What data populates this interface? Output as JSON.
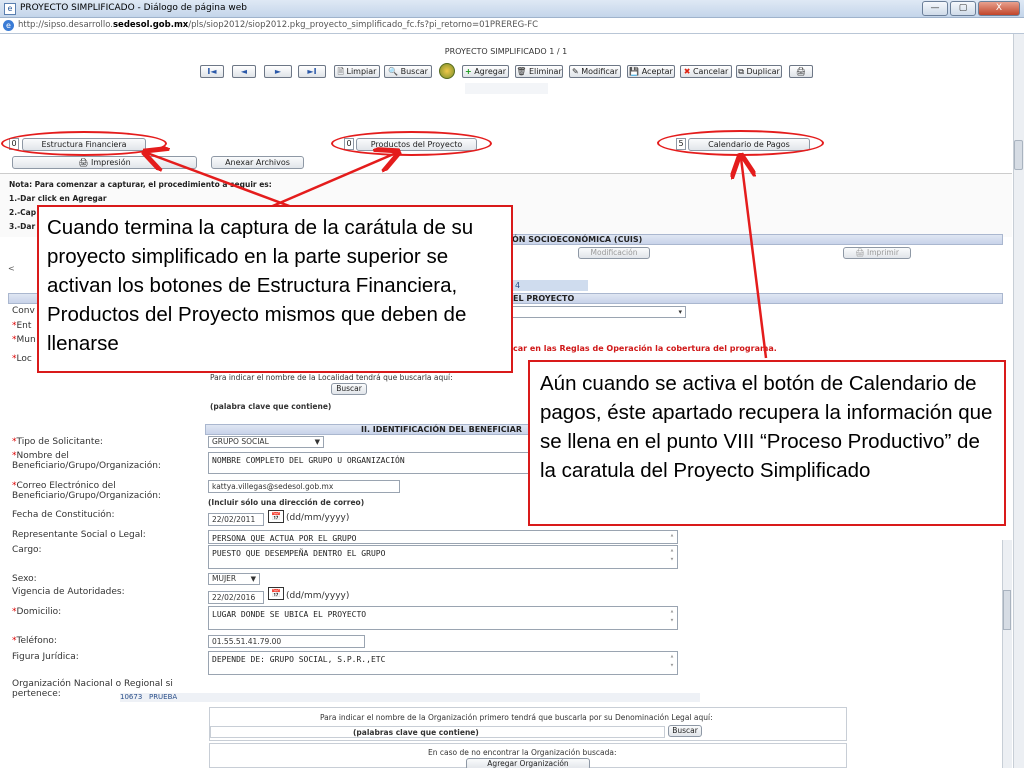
{
  "window": {
    "title": "PROYECTO SIMPLIFICADO - Diálogo de página web",
    "url_prefix": "http://sipso.desarrollo.",
    "url_domain": "sedesol.gob.mx",
    "url_suffix": "/pls/siop2012/siop2012.pkg_proyecto_simplificado_fc.fs?pi_retorno=01PREREG-FC",
    "minimize": "—",
    "maximize": "▢",
    "close": "X"
  },
  "header": {
    "title": "PROYECTO SIMPLIFICADO 1 / 1"
  },
  "toolbar": {
    "first": "I◄",
    "prev": "◄",
    "next": "►",
    "last": "►I",
    "limpiar": "Limpiar",
    "buscar": "Buscar",
    "agregar": "Agregar",
    "eliminar": "Eliminar",
    "modificar": "Modificar",
    "aceptar": "Aceptar",
    "cancelar": "Cancelar",
    "duplicar": "Duplicar"
  },
  "action_buttons": {
    "estructura_count": "0",
    "estructura": "Estructura Financiera",
    "productos_count": "0",
    "productos": "Productos del Proyecto",
    "calendario_count": "5",
    "calendario": "Calendario de Pagos",
    "impresion": "Impresión",
    "anexar": "Anexar Archivos"
  },
  "notes": {
    "line1": "Nota: Para comenzar a capturar, el procedimiento a seguir es:",
    "line2": "1.-Dar click en Agregar",
    "line3": "2.-Cap",
    "line4": "3.-Dar"
  },
  "cuis": {
    "section": "ÓN SOCIOECONÓMICA (CUIS)",
    "modificacion": "Modificación",
    "imprimir": "Imprimir"
  },
  "proyecto": {
    "section": "EL PROYECTO",
    "tab": "4",
    "warning": "car en las Reglas de Operación la cobertura del programa.",
    "conv_label": "Conv",
    "ent_label": "Ent",
    "mun_label": "Mun",
    "loc_label": "Loc",
    "loc_hint": "Para indicar el nombre de la Localidad tendrá que buscarla aquí:",
    "buscar": "Buscar",
    "keyword_hint": "(palabra clave que contiene)"
  },
  "beneficiario": {
    "section": "II. IDENTIFICACIÓN DEL BENEFICIAR",
    "tipo_label": "Tipo de Solicitante:",
    "tipo_value": "GRUPO SOCIAL",
    "nombre_label": "Nombre del Beneficiario/Grupo/Organización:",
    "nombre_value": "NOMBRE COMPLETO DEL GRUPO U ORGANIZACIÓN",
    "correo_label": "Correo Electrónico del Beneficiario/Grupo/Organización:",
    "correo_value": "kattya.villegas@sedesol.gob.mx",
    "correo_hint": "(Incluir sólo una dirección de correo)",
    "fecha_label": "Fecha de Constitución:",
    "fecha_value": "22/02/2011",
    "date_format": "(dd/mm/yyyy)",
    "rep_label": "Representante Social o Legal:",
    "rep_value": "PERSONA QUE ACTUA POR EL GRUPO",
    "cargo_label": "Cargo:",
    "cargo_value": "PUESTO QUE DESEMPEÑA DENTRO EL GRUPO",
    "sexo_label": "Sexo:",
    "sexo_value": "MUJER",
    "vigencia_label": "Vigencia de Autoridades:",
    "vigencia_value": "22/02/2016",
    "domicilio_label": "Domicilio:",
    "domicilio_value": "LUGAR DONDE SE UBICA EL PROYECTO",
    "telefono_label": "Teléfono:",
    "telefono_value": "01.55.51.41.79.00",
    "figura_label": "Figura Jurídica:",
    "figura_value": "DEPENDE DE: GRUPO SOCIAL, S.P.R.,ETC",
    "org_label": "Organización Nacional o Regional si pertenece:",
    "org_code": "10673",
    "org_name": "PRUEBA",
    "org_hint": "Para indicar el nombre de la Organización primero tendrá que buscarla por su Denominación Legal aquí:",
    "org_keyword": "(palabras clave que contiene)",
    "org_buscar": "Buscar",
    "org_notfound": "En caso de no encontrar la Organización buscada:",
    "org_agregar": "Agregar Organización"
  },
  "callouts": {
    "left": "Cuando termina la captura de la carátula de su proyecto simplificado en la parte superior se activan los botones de Estructura Financiera, Productos del Proyecto mismos que deben de llenarse",
    "right": "Aún cuando se activa el botón de Calendario de pagos, éste  apartado recupera la información que se llena en el punto VIII “Proceso Productivo” de la caratula del Proyecto Simplificado"
  },
  "colors": {
    "annotation": "#e41c1c",
    "section_bar": "#c8d3ea",
    "required": "#dd0000"
  }
}
